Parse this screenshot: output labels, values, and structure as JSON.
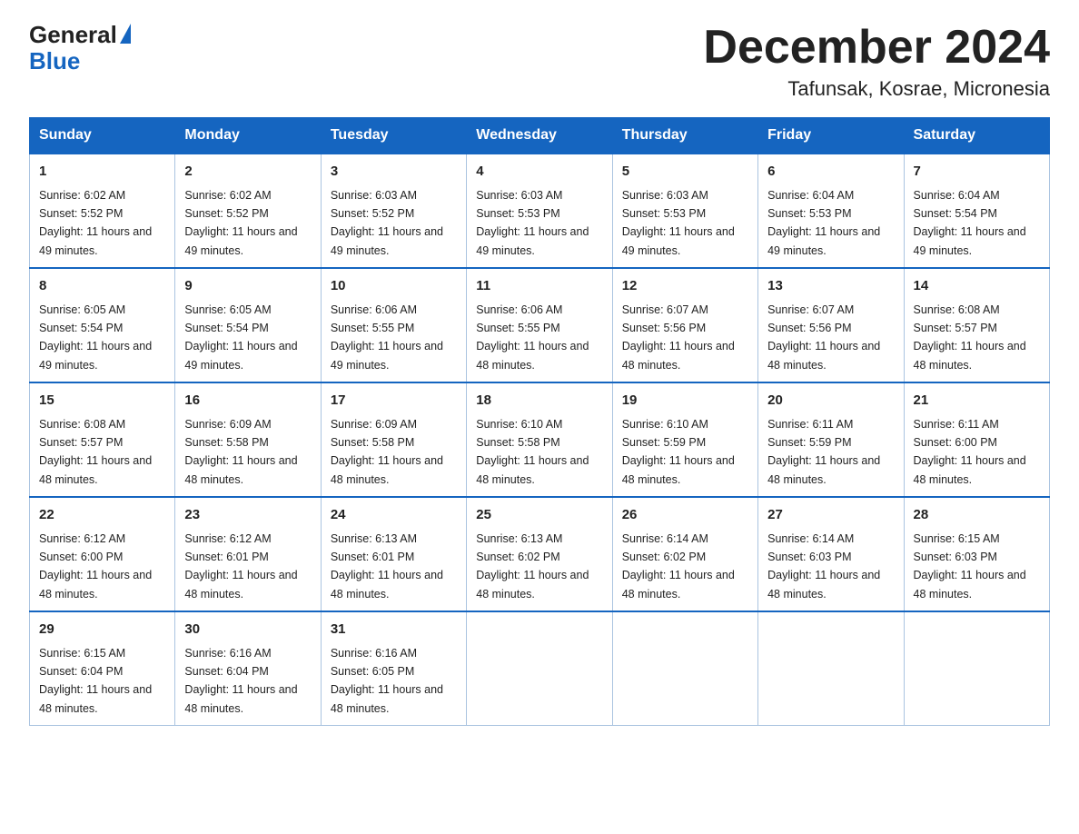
{
  "logo": {
    "line1": "General",
    "line2": "Blue",
    "triangle": "▶"
  },
  "title": "December 2024",
  "subtitle": "Tafunsak, Kosrae, Micronesia",
  "headers": [
    "Sunday",
    "Monday",
    "Tuesday",
    "Wednesday",
    "Thursday",
    "Friday",
    "Saturday"
  ],
  "weeks": [
    [
      {
        "day": "1",
        "sunrise": "6:02 AM",
        "sunset": "5:52 PM",
        "daylight": "11 hours and 49 minutes."
      },
      {
        "day": "2",
        "sunrise": "6:02 AM",
        "sunset": "5:52 PM",
        "daylight": "11 hours and 49 minutes."
      },
      {
        "day": "3",
        "sunrise": "6:03 AM",
        "sunset": "5:52 PM",
        "daylight": "11 hours and 49 minutes."
      },
      {
        "day": "4",
        "sunrise": "6:03 AM",
        "sunset": "5:53 PM",
        "daylight": "11 hours and 49 minutes."
      },
      {
        "day": "5",
        "sunrise": "6:03 AM",
        "sunset": "5:53 PM",
        "daylight": "11 hours and 49 minutes."
      },
      {
        "day": "6",
        "sunrise": "6:04 AM",
        "sunset": "5:53 PM",
        "daylight": "11 hours and 49 minutes."
      },
      {
        "day": "7",
        "sunrise": "6:04 AM",
        "sunset": "5:54 PM",
        "daylight": "11 hours and 49 minutes."
      }
    ],
    [
      {
        "day": "8",
        "sunrise": "6:05 AM",
        "sunset": "5:54 PM",
        "daylight": "11 hours and 49 minutes."
      },
      {
        "day": "9",
        "sunrise": "6:05 AM",
        "sunset": "5:54 PM",
        "daylight": "11 hours and 49 minutes."
      },
      {
        "day": "10",
        "sunrise": "6:06 AM",
        "sunset": "5:55 PM",
        "daylight": "11 hours and 49 minutes."
      },
      {
        "day": "11",
        "sunrise": "6:06 AM",
        "sunset": "5:55 PM",
        "daylight": "11 hours and 48 minutes."
      },
      {
        "day": "12",
        "sunrise": "6:07 AM",
        "sunset": "5:56 PM",
        "daylight": "11 hours and 48 minutes."
      },
      {
        "day": "13",
        "sunrise": "6:07 AM",
        "sunset": "5:56 PM",
        "daylight": "11 hours and 48 minutes."
      },
      {
        "day": "14",
        "sunrise": "6:08 AM",
        "sunset": "5:57 PM",
        "daylight": "11 hours and 48 minutes."
      }
    ],
    [
      {
        "day": "15",
        "sunrise": "6:08 AM",
        "sunset": "5:57 PM",
        "daylight": "11 hours and 48 minutes."
      },
      {
        "day": "16",
        "sunrise": "6:09 AM",
        "sunset": "5:58 PM",
        "daylight": "11 hours and 48 minutes."
      },
      {
        "day": "17",
        "sunrise": "6:09 AM",
        "sunset": "5:58 PM",
        "daylight": "11 hours and 48 minutes."
      },
      {
        "day": "18",
        "sunrise": "6:10 AM",
        "sunset": "5:58 PM",
        "daylight": "11 hours and 48 minutes."
      },
      {
        "day": "19",
        "sunrise": "6:10 AM",
        "sunset": "5:59 PM",
        "daylight": "11 hours and 48 minutes."
      },
      {
        "day": "20",
        "sunrise": "6:11 AM",
        "sunset": "5:59 PM",
        "daylight": "11 hours and 48 minutes."
      },
      {
        "day": "21",
        "sunrise": "6:11 AM",
        "sunset": "6:00 PM",
        "daylight": "11 hours and 48 minutes."
      }
    ],
    [
      {
        "day": "22",
        "sunrise": "6:12 AM",
        "sunset": "6:00 PM",
        "daylight": "11 hours and 48 minutes."
      },
      {
        "day": "23",
        "sunrise": "6:12 AM",
        "sunset": "6:01 PM",
        "daylight": "11 hours and 48 minutes."
      },
      {
        "day": "24",
        "sunrise": "6:13 AM",
        "sunset": "6:01 PM",
        "daylight": "11 hours and 48 minutes."
      },
      {
        "day": "25",
        "sunrise": "6:13 AM",
        "sunset": "6:02 PM",
        "daylight": "11 hours and 48 minutes."
      },
      {
        "day": "26",
        "sunrise": "6:14 AM",
        "sunset": "6:02 PM",
        "daylight": "11 hours and 48 minutes."
      },
      {
        "day": "27",
        "sunrise": "6:14 AM",
        "sunset": "6:03 PM",
        "daylight": "11 hours and 48 minutes."
      },
      {
        "day": "28",
        "sunrise": "6:15 AM",
        "sunset": "6:03 PM",
        "daylight": "11 hours and 48 minutes."
      }
    ],
    [
      {
        "day": "29",
        "sunrise": "6:15 AM",
        "sunset": "6:04 PM",
        "daylight": "11 hours and 48 minutes."
      },
      {
        "day": "30",
        "sunrise": "6:16 AM",
        "sunset": "6:04 PM",
        "daylight": "11 hours and 48 minutes."
      },
      {
        "day": "31",
        "sunrise": "6:16 AM",
        "sunset": "6:05 PM",
        "daylight": "11 hours and 48 minutes."
      },
      null,
      null,
      null,
      null
    ]
  ]
}
